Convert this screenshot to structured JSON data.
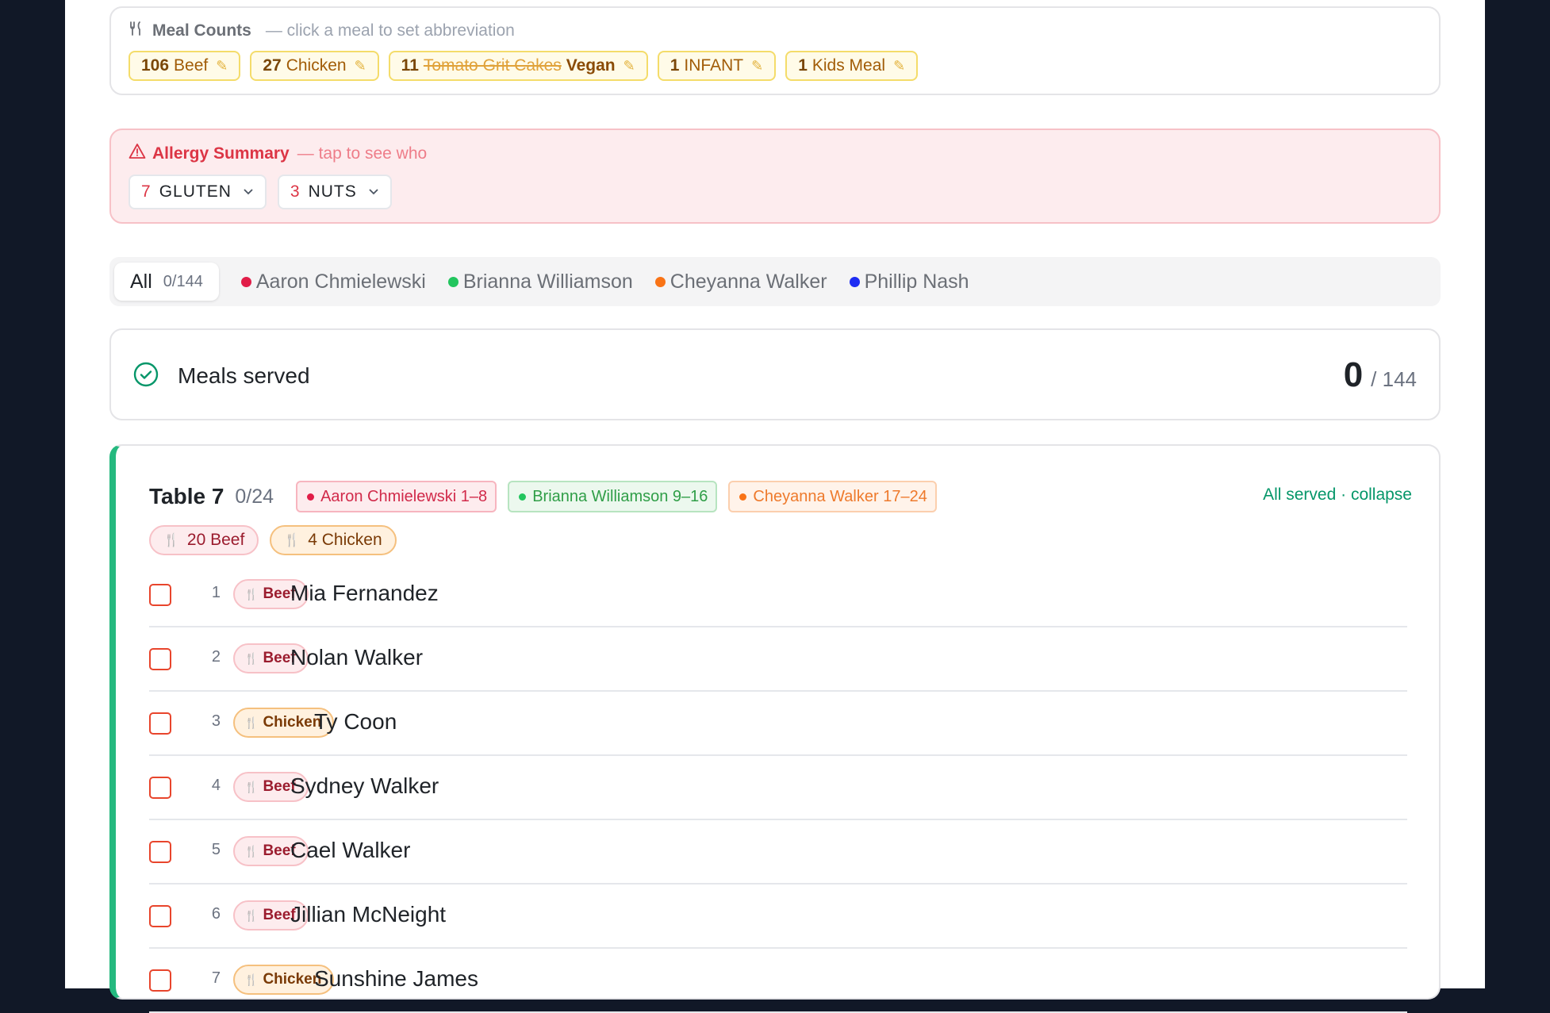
{
  "meal_counts": {
    "title": "Meal Counts",
    "subtitle": "— click a meal to set abbreviation",
    "items": [
      {
        "count": "106",
        "strike": "",
        "label": "Beef",
        "strong": false
      },
      {
        "count": "27",
        "strike": "",
        "label": "Chicken",
        "strong": false
      },
      {
        "count": "11",
        "strike": "Tomato Grit Cakes",
        "label": "Vegan",
        "strong": true
      },
      {
        "count": "1",
        "strike": "",
        "label": "INFANT",
        "strong": false
      },
      {
        "count": "1",
        "strike": "",
        "label": "Kids Meal",
        "strong": false
      }
    ]
  },
  "allergy": {
    "title": "Allergy Summary",
    "subtitle": "— tap to see who",
    "items": [
      {
        "count": "7",
        "label": "GLUTEN"
      },
      {
        "count": "3",
        "label": "NUTS"
      }
    ]
  },
  "filters": {
    "all_label": "All",
    "all_count": "0/144",
    "servers": [
      {
        "name": "Aaron Chmielewski",
        "color": "#e11d48"
      },
      {
        "name": "Brianna Williamson",
        "color": "#22c55e"
      },
      {
        "name": "Cheyanna Walker",
        "color": "#f97316"
      },
      {
        "name": "Phillip Nash",
        "color": "#1d2cf3"
      }
    ]
  },
  "served": {
    "label": "Meals served",
    "count": "0",
    "total": "/ 144"
  },
  "table": {
    "title": "Table 7",
    "count": "0/24",
    "servers": [
      {
        "label": "Aaron Chmielewski 1–8",
        "color": "#e11d48"
      },
      {
        "label": "Brianna Williamson 9–16",
        "color": "#22c55e"
      },
      {
        "label": "Cheyanna Walker 17–24",
        "color": "#f97316"
      }
    ],
    "actions": "All served · collapse",
    "meal_totals": [
      {
        "label": "20 Beef",
        "kind": "beef"
      },
      {
        "label": "4 Chicken",
        "kind": "chicken"
      }
    ],
    "guests": [
      {
        "seat": "1",
        "meal": "Beef",
        "name": "Mia Fernandez"
      },
      {
        "seat": "2",
        "meal": "Beef",
        "name": "Nolan Walker"
      },
      {
        "seat": "3",
        "meal": "Chicken",
        "name": "Ty Coon"
      },
      {
        "seat": "4",
        "meal": "Beef",
        "name": "Sydney Walker"
      },
      {
        "seat": "5",
        "meal": "Beef",
        "name": "Cael Walker"
      },
      {
        "seat": "6",
        "meal": "Beef",
        "name": "Jillian McNeight"
      },
      {
        "seat": "7",
        "meal": "Chicken",
        "name": "Sunshine James"
      }
    ]
  }
}
